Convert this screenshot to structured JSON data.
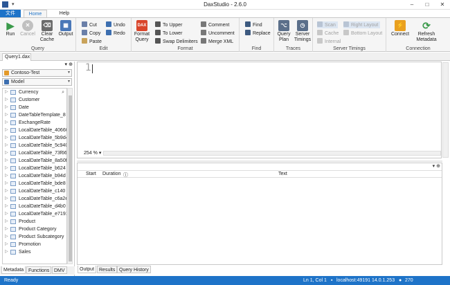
{
  "window": {
    "title": "DaxStudio - 2.6.0",
    "minimize": "–",
    "maximize": "□",
    "close": "✕"
  },
  "quick_access": "▾",
  "tabs": {
    "file": "文件",
    "home": "Home",
    "help": "Help"
  },
  "ribbon": {
    "query": {
      "label": "Query",
      "run": "Run",
      "cancel": "Cancel",
      "clear_cache": "Clear Cache",
      "output": "Output"
    },
    "edit": {
      "label": "Edit",
      "cut": "Cut",
      "copy": "Copy",
      "paste": "Paste",
      "undo": "Undo",
      "redo": "Redo"
    },
    "format": {
      "label": "Format",
      "format_query": "Format Query",
      "to_upper": "To Upper",
      "to_lower": "To Lower",
      "swap_delimiters": "Swap Delimiters",
      "comment": "Comment",
      "uncomment": "Uncomment",
      "merge_xml": "Merge XML",
      "dax_logo": "DAX"
    },
    "find": {
      "label": "Find",
      "find": "Find",
      "replace": "Replace"
    },
    "traces": {
      "label": "Traces",
      "query_plan": "Query Plan",
      "server_timings": "Server Timings"
    },
    "server_timings": {
      "label": "Server Timings",
      "scan": "Scan",
      "cache": "Cache",
      "internal": "Internal",
      "right_layout": "Right Layout",
      "bottom_layout": "Bottom Layout"
    },
    "connection": {
      "label": "Connection",
      "connect": "Connect",
      "refresh_metadata": "Refresh Metadata"
    }
  },
  "document_tab": "Query1.dax",
  "metadata": {
    "database": "Contoso-Test",
    "model": "Model",
    "tables": [
      "Currency",
      "Customer",
      "Date",
      "DateTableTemplate_8",
      "ExchangeRate",
      "LocalDateTable_40660",
      "LocalDateTable_5b9d4",
      "LocalDateTable_5c940",
      "LocalDateTable_73f66",
      "LocalDateTable_8a50f",
      "LocalDateTable_b624",
      "LocalDateTable_b94d",
      "LocalDateTable_bde8",
      "LocalDateTable_c140",
      "LocalDateTable_c6a2e",
      "LocalDateTable_d4b0",
      "LocalDateTable_e7191",
      "Product",
      "Product Category",
      "Product Subcategory",
      "Promotion",
      "Sales"
    ]
  },
  "left_tabs": [
    "Metadata",
    "Functions",
    "DMV"
  ],
  "editor": {
    "line_number": "1",
    "zoom": "254 %"
  },
  "output": {
    "columns": [
      "Start",
      "Duration",
      "Text"
    ],
    "tabs": [
      "Output",
      "Results",
      "Query History"
    ]
  },
  "status": {
    "ready": "Ready",
    "position": "Ln 1, Col 1",
    "server": "localhost:49191",
    "version": "14.0.1.253",
    "spid": "270"
  },
  "colors": {
    "accent": "#1e73c8",
    "run": "#3a9a4a",
    "cancel": "#b0b0b0",
    "dax": "#d9452b",
    "connect": "#e9a020",
    "refresh": "#3a9a4a"
  }
}
